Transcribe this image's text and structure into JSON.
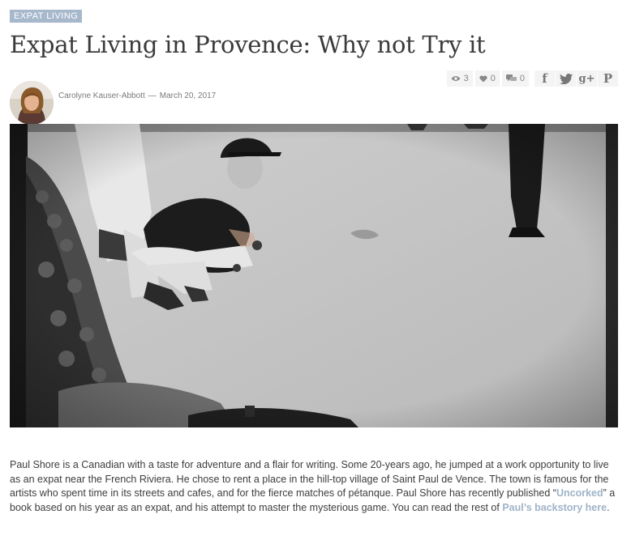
{
  "category": "EXPAT LIVING",
  "title": "Expat Living in Provence: Why not Try it",
  "stats": {
    "views": "3",
    "likes": "0",
    "comments": "0"
  },
  "share": {
    "facebook": "f",
    "twitter": "t",
    "google_plus": "g+",
    "pinterest": "P"
  },
  "byline": {
    "author": "Carolyne Kauser-Abbott",
    "separator": "—",
    "date": "March 20, 2017"
  },
  "article": {
    "text_1": "Paul Shore is a Canadian with a taste for adventure and a flair for writing. Some 20-years ago, he jumped at a work opportunity to live as an expat near the French Riviera. He chose to rent a place in the hill-top village of Saint Paul de Vence. The town is famous for the artists who spent time in its streets and cafes, and for the fierce matches of pétanque. Paul Shore has recently published “",
    "link_1": "Uncorked",
    "text_2": "” a book based on his year as an expat, and his attempt to master the mysterious game. You can read the rest of ",
    "link_2": "Paul’s backstory here",
    "text_3": "."
  },
  "colors": {
    "category_bg": "#a7b8cd",
    "link": "#9fb3c8",
    "title": "#3a3a3a"
  }
}
